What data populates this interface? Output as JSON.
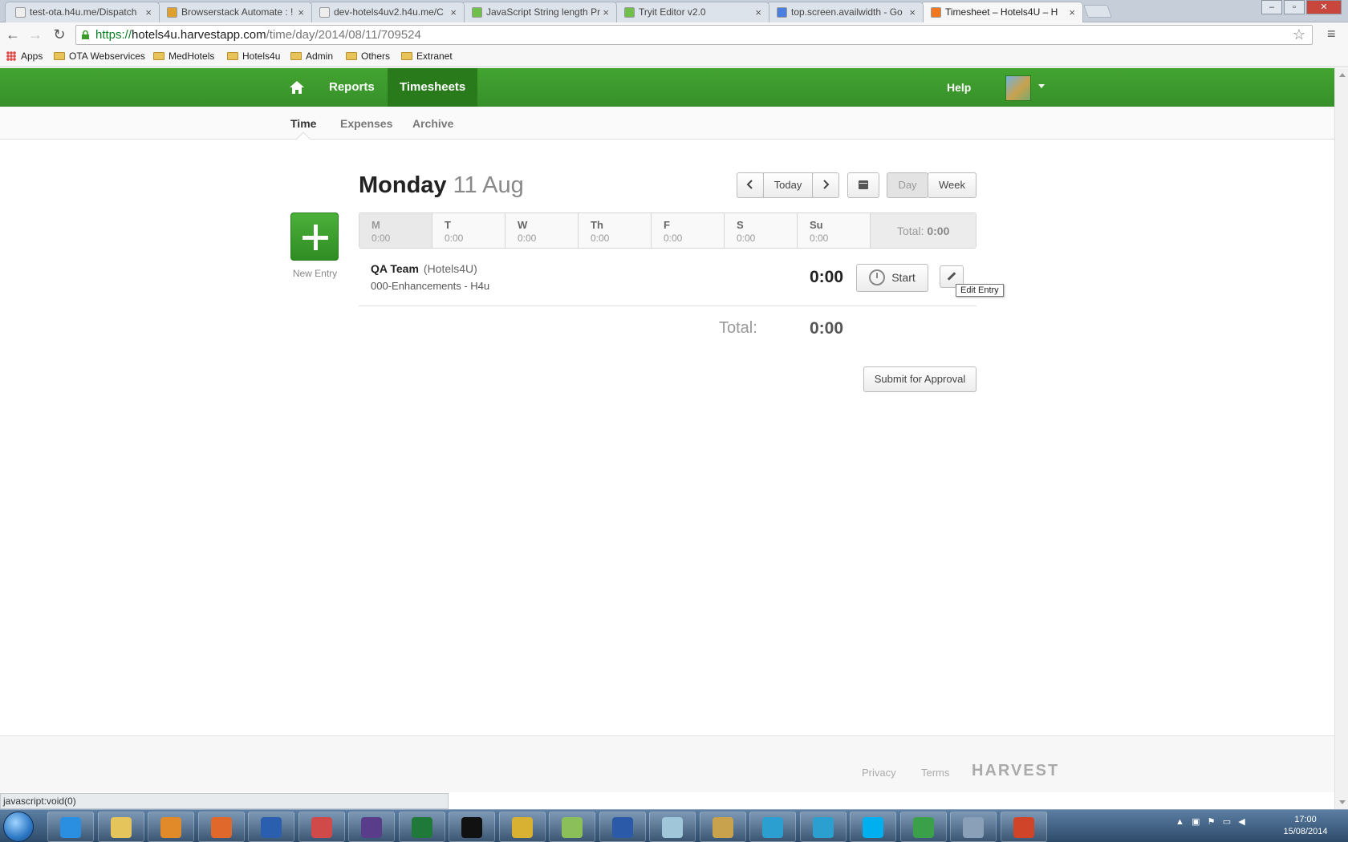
{
  "browser": {
    "tabs": [
      {
        "title": "test-ota.h4u.me/Dispatch",
        "favicon": "document-icon",
        "color": "#eeeeee"
      },
      {
        "title": "Browserstack Automate : !",
        "favicon": "chrome-icon",
        "color": "#e0a030"
      },
      {
        "title": "dev-hotels4uv2.h4u.me/C",
        "favicon": "document-icon",
        "color": "#eeeeee"
      },
      {
        "title": "JavaScript String length Pr",
        "favicon": "w3schools-icon",
        "color": "#6fbf4a"
      },
      {
        "title": "Tryit Editor v2.0",
        "favicon": "w3schools-icon",
        "color": "#6fbf4a"
      },
      {
        "title": "top.screen.availwidth - Go",
        "favicon": "google-icon",
        "color": "#4a7fe0"
      },
      {
        "title": "Timesheet – Hotels4U – H",
        "favicon": "harvest-icon",
        "color": "#f2781f"
      }
    ],
    "url": {
      "scheme": "https://",
      "host": "hotels4u.harvestapp.com",
      "path": "/time/day/2014/08/11/709524"
    },
    "bookmarks": [
      {
        "label": "Apps",
        "icon": "apps-grid-icon"
      },
      {
        "label": "OTA Webservices",
        "icon": "folder-icon"
      },
      {
        "label": "MedHotels",
        "icon": "folder-icon"
      },
      {
        "label": "Hotels4u",
        "icon": "folder-icon"
      },
      {
        "label": "Admin",
        "icon": "folder-icon"
      },
      {
        "label": "Others",
        "icon": "folder-icon"
      },
      {
        "label": "Extranet",
        "icon": "folder-icon"
      }
    ],
    "status_text": "javascript:void(0)"
  },
  "header": {
    "brand_color": "#3c9a2b",
    "nav": [
      "Reports",
      "Timesheets"
    ],
    "active_nav": "Timesheets",
    "help": "Help"
  },
  "subnav": {
    "items": [
      "Time",
      "Expenses",
      "Archive"
    ],
    "active": "Time"
  },
  "day": {
    "name": "Monday",
    "date": "11 Aug"
  },
  "controls": {
    "today": "Today",
    "day": "Day",
    "week": "Week"
  },
  "new_entry_label": "New Entry",
  "week": {
    "days": [
      {
        "label": "M",
        "value": "0:00",
        "selected": true
      },
      {
        "label": "T",
        "value": "0:00"
      },
      {
        "label": "W",
        "value": "0:00"
      },
      {
        "label": "Th",
        "value": "0:00"
      },
      {
        "label": "F",
        "value": "0:00"
      },
      {
        "label": "S",
        "value": "0:00"
      },
      {
        "label": "Su",
        "value": "0:00"
      }
    ],
    "total_label": "Total:",
    "total_value": "0:00"
  },
  "entry": {
    "project": "QA Team",
    "client": "(Hotels4U)",
    "task": "000-Enhancements - H4u",
    "time": "0:00",
    "start_label": "Start",
    "edit_tooltip": "Edit Entry"
  },
  "day_total": {
    "label": "Total:",
    "value": "0:00"
  },
  "submit_label": "Submit for Approval",
  "footer": {
    "privacy": "Privacy",
    "terms": "Terms",
    "logo": "HARVEST"
  },
  "taskbar": {
    "time": "17:00",
    "date": "15/08/2014",
    "apps": [
      {
        "name": "internet-explorer-icon",
        "color": "#2a8fe0"
      },
      {
        "name": "file-explorer-icon",
        "color": "#e6c45c"
      },
      {
        "name": "media-player-icon",
        "color": "#e08a2a"
      },
      {
        "name": "firefox-icon",
        "color": "#e0682a"
      },
      {
        "name": "outlook-icon",
        "color": "#2a5fb0"
      },
      {
        "name": "snipping-tool-icon",
        "color": "#d04a4a"
      },
      {
        "name": "eclipse-icon",
        "color": "#5a3d8a"
      },
      {
        "name": "excel-icon",
        "color": "#1f7a3a"
      },
      {
        "name": "command-prompt-icon",
        "color": "#111111"
      },
      {
        "name": "chrome-icon",
        "color": "#d9b132"
      },
      {
        "name": "notepad-plus-icon",
        "color": "#8bbf5a"
      },
      {
        "name": "word-icon",
        "color": "#2a5aa8"
      },
      {
        "name": "notepad-icon",
        "color": "#9fc6d9"
      },
      {
        "name": "tools-icon",
        "color": "#c9a24e"
      },
      {
        "name": "webstorm-icon",
        "color": "#2a9fd0"
      },
      {
        "name": "webstorm-icon-2",
        "color": "#2a9fd0"
      },
      {
        "name": "skype-icon",
        "color": "#00aff0"
      },
      {
        "name": "green-app-icon",
        "color": "#3aa04a"
      },
      {
        "name": "calculator-icon",
        "color": "#8aa0b8"
      },
      {
        "name": "headphones-icon",
        "color": "#d0452a"
      }
    ]
  }
}
